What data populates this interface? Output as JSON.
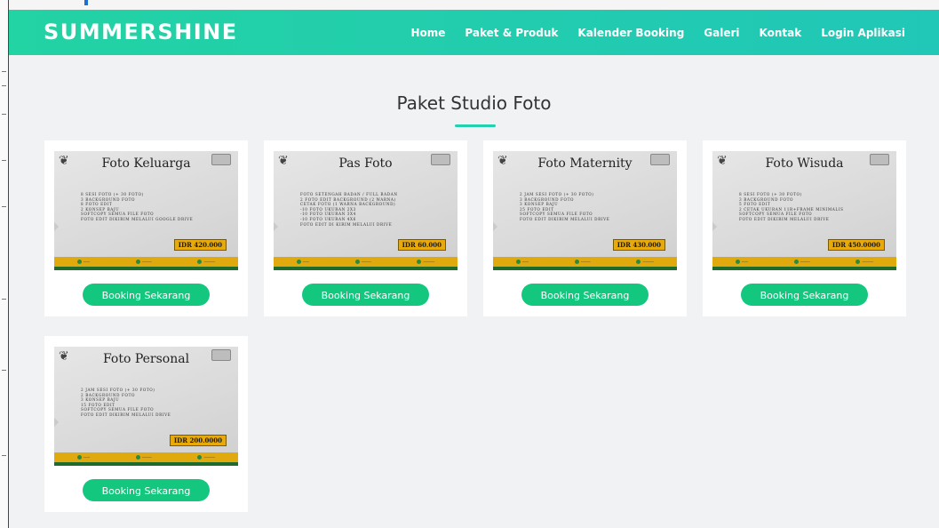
{
  "brand": "SUMMERSHINE",
  "nav": [
    "Home",
    "Paket & Produk",
    "Kalender Booking",
    "Galeri",
    "Kontak",
    "Login Aplikasi"
  ],
  "section_title": "Paket Studio Foto",
  "booking_label": "Booking Sekarang",
  "packages": [
    {
      "title": "Foto Keluarga",
      "lines": [
        "8 SESI FOTO (+ 30 FOTO)",
        "3 BACKGROUND FOTO",
        "8 FOTO EDIT",
        "2 KONSEP BAJU",
        "SOFTCOPY SEMUA FILE FOTO",
        "FOTO EDIT DIKIRIM MELALUI GOOGLE DRIVE"
      ],
      "price": "IDR 420.000"
    },
    {
      "title": "Pas Foto",
      "lines": [
        "FOTO SETENGAH BADAN / FULL BADAN",
        "2 FOTO EDIT BACKGROUND (2 WARNA)",
        "CETAK FOTO (1 WARNA BACKGROUND)",
        "-10 FOTO UKURAN 2X3",
        "-10 FOTO UKURAN 3X4",
        "-10 FOTO UKURAN 4X6",
        "FOTO EDIT DI KIRIM MELALUI DRIVE"
      ],
      "price": "IDR 60.000"
    },
    {
      "title": "Foto Maternity",
      "lines": [
        "2 JAM SESI FOTO (+ 30 FOTO)",
        "3 BACKGROUND FOTO",
        "3 KONSEP BAJU",
        "25 FOTO EDIT",
        "SOFTCOPY SEMUA FILE FOTO",
        "FOTO EDIT DIKIRIM MELALUI DRIVE"
      ],
      "price": "IDR 430.000"
    },
    {
      "title": "Foto Wisuda",
      "lines": [
        "8 SESI FOTO (+ 30 FOTO)",
        "3 BACKGROUND FOTO",
        "5 FOTO EDIT",
        "2 CETAK UKURAN 11R+FRAME MINIMALIS",
        "SOFTCOPY SEMUA FILE FOTO",
        "FOTO EDIT DIKIRIM MELALUI DRIVE"
      ],
      "price": "IDR 450.0000"
    },
    {
      "title": "Foto Personal",
      "lines": [
        "2 JAM SESI FOTO (+ 30 FOTO)",
        "2 BACKGROUND FOTO",
        "3 KONSEP BAJU",
        "15 FOTO EDIT",
        "SOFTCOPY SEMUA FILE FOTO",
        "FOTO EDIT DIKIRIM MELALUI DRIVE"
      ],
      "price": "IDR 200.0000"
    }
  ],
  "colors": {
    "accent": "#22d3a4",
    "button": "#14c77f",
    "price_bg": "#e8a90a"
  }
}
